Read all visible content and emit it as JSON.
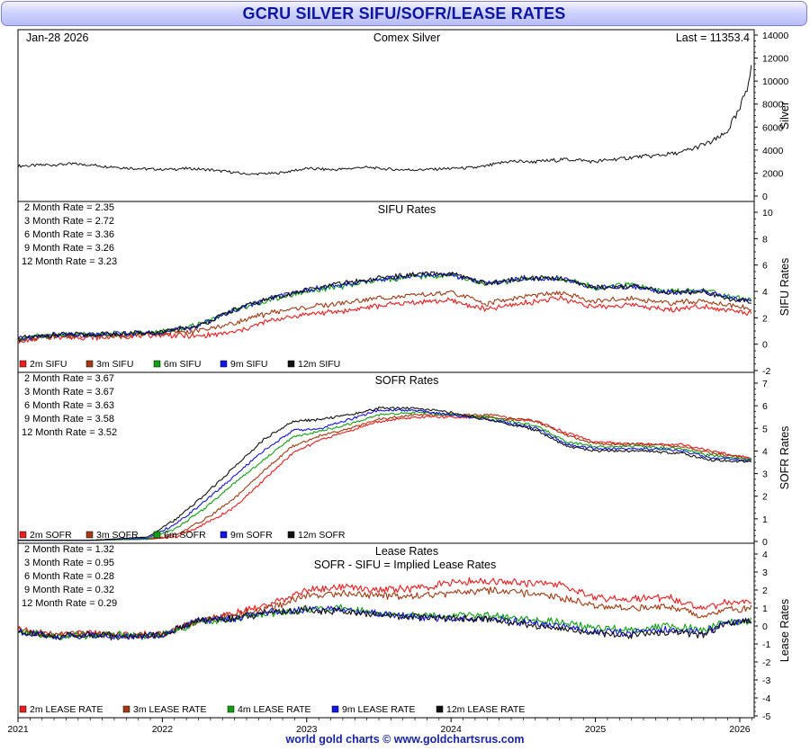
{
  "title": "GCRU SILVER SIFU/SOFR/LEASE RATES",
  "footer": "world gold charts © www.goldchartsrus.com",
  "colors": {
    "title_text": "#0c16a3",
    "footer_text": "#1a24a8",
    "2m": "#ee1c1c",
    "3m": "#a33a12",
    "6m": "#10a010",
    "9m": "#1414e6",
    "12m": "#111111"
  },
  "x_axis": {
    "ticks": [
      "2021",
      "2022",
      "2023",
      "2024",
      "2025",
      "2026"
    ]
  },
  "chart_data": [
    {
      "type": "line",
      "panel": "silver",
      "date_label": "Jan-28 2026",
      "title": "Comex Silver",
      "last_label": "Last = 11353.4",
      "ylabel": "Silver",
      "ylim": [
        0,
        14000
      ],
      "yticks": [
        "0",
        "2000",
        "4000",
        "6000",
        "8000",
        "10000",
        "12000",
        "14000"
      ],
      "x": [
        2021.0,
        2021.2,
        2021.4,
        2021.6,
        2021.8,
        2022.0,
        2022.2,
        2022.4,
        2022.6,
        2022.8,
        2023.0,
        2023.2,
        2023.4,
        2023.6,
        2023.8,
        2024.0,
        2024.2,
        2024.4,
        2024.6,
        2024.8,
        2025.0,
        2025.2,
        2025.4,
        2025.6,
        2025.8,
        2025.9,
        2026.0,
        2026.05,
        2026.08
      ],
      "series": [
        {
          "values": [
            2600,
            2700,
            2800,
            2600,
            2400,
            2300,
            2400,
            2200,
            1900,
            2000,
            2400,
            2300,
            2500,
            2300,
            2300,
            2400,
            2500,
            3000,
            3000,
            3200,
            3000,
            3300,
            3500,
            3800,
            4700,
            5400,
            7500,
            9500,
            11353
          ]
        }
      ]
    },
    {
      "type": "line",
      "panel": "sifu",
      "title": "SIFU Rates",
      "ylabel": "SIFU Rates",
      "ylim": [
        -2,
        10
      ],
      "yticks": [
        "-2",
        "0",
        "2",
        "4",
        "6",
        "8",
        "10"
      ],
      "rate_labels": [
        "2 Month Rate = 2.35",
        "3 Month Rate = 2.72",
        "6 Month Rate = 3.36",
        "9 Month Rate = 3.26",
        "12 Month Rate = 3.23"
      ],
      "legend": [
        "2m SIFU",
        "3m SIFU",
        "6m SIFU",
        "9m SIFU",
        "12m SIFU"
      ],
      "x": [
        2021.0,
        2021.25,
        2021.5,
        2021.75,
        2022.0,
        2022.25,
        2022.5,
        2022.75,
        2023.0,
        2023.25,
        2023.5,
        2023.75,
        2024.0,
        2024.25,
        2024.5,
        2024.75,
        2025.0,
        2025.25,
        2025.5,
        2025.75,
        2025.9,
        2026.08
      ],
      "series": [
        {
          "name": "2m SIFU",
          "values": [
            0.2,
            0.6,
            0.5,
            0.6,
            0.7,
            0.6,
            0.9,
            1.8,
            2.3,
            2.5,
            2.9,
            3.2,
            3.3,
            2.6,
            3.1,
            3.5,
            2.8,
            3.0,
            2.6,
            2.9,
            2.6,
            2.35
          ]
        },
        {
          "name": "3m SIFU",
          "values": [
            0.3,
            0.6,
            0.6,
            0.7,
            0.8,
            1.0,
            1.6,
            2.4,
            2.8,
            3.1,
            3.5,
            3.7,
            3.9,
            3.1,
            3.6,
            3.9,
            3.2,
            3.5,
            3.1,
            3.3,
            3.0,
            2.72
          ]
        },
        {
          "name": "6m SIFU",
          "values": [
            0.4,
            0.7,
            0.7,
            0.8,
            0.9,
            1.5,
            2.6,
            3.4,
            4.0,
            4.4,
            4.8,
            5.1,
            5.2,
            4.5,
            4.9,
            5.0,
            4.3,
            4.5,
            4.0,
            4.1,
            3.7,
            3.36
          ]
        },
        {
          "name": "9m SIFU",
          "values": [
            0.4,
            0.7,
            0.7,
            0.8,
            0.9,
            1.4,
            2.6,
            3.5,
            4.1,
            4.5,
            4.9,
            5.2,
            5.3,
            4.6,
            5.0,
            5.0,
            4.3,
            4.4,
            3.9,
            4.0,
            3.6,
            3.26
          ]
        },
        {
          "name": "12m SIFU",
          "values": [
            0.4,
            0.7,
            0.7,
            0.8,
            0.9,
            1.4,
            2.6,
            3.5,
            4.1,
            4.6,
            5.0,
            5.3,
            5.3,
            4.6,
            5.0,
            5.0,
            4.3,
            4.4,
            3.9,
            4.0,
            3.5,
            3.23
          ]
        }
      ]
    },
    {
      "type": "line",
      "panel": "sofr",
      "title": "SOFR Rates",
      "ylabel": "SOFR Rates",
      "ylim": [
        0,
        7
      ],
      "yticks": [
        "0",
        "1",
        "2",
        "3",
        "4",
        "5",
        "6",
        "7"
      ],
      "rate_labels": [
        "2 Month Rate = 3.67",
        "3 Month Rate = 3.67",
        "6 Month Rate = 3.63",
        "9 Month Rate = 3.58",
        "12 Month Rate = 3.52"
      ],
      "legend": [
        "2m SOFR",
        "3m SOFR",
        "6m SOFR",
        "9m SOFR",
        "12m SOFR"
      ],
      "x": [
        2021.0,
        2021.5,
        2021.9,
        2022.1,
        2022.3,
        2022.5,
        2022.7,
        2022.9,
        2023.1,
        2023.3,
        2023.5,
        2023.75,
        2024.0,
        2024.25,
        2024.6,
        2024.8,
        2025.0,
        2025.3,
        2025.6,
        2025.8,
        2026.08
      ],
      "series": [
        {
          "name": "2m SOFR",
          "values": [
            0.05,
            0.05,
            0.1,
            0.2,
            0.8,
            1.5,
            2.7,
            3.9,
            4.5,
            4.9,
            5.3,
            5.5,
            5.5,
            5.5,
            5.3,
            4.8,
            4.4,
            4.3,
            4.3,
            4.0,
            3.67
          ]
        },
        {
          "name": "3m SOFR",
          "values": [
            0.05,
            0.05,
            0.1,
            0.3,
            1.0,
            1.9,
            3.1,
            4.2,
            4.7,
            5.0,
            5.4,
            5.6,
            5.6,
            5.6,
            5.3,
            4.7,
            4.3,
            4.3,
            4.2,
            3.9,
            3.67
          ]
        },
        {
          "name": "6m SOFR",
          "values": [
            0.05,
            0.05,
            0.1,
            0.6,
            1.5,
            2.6,
            3.6,
            4.6,
            4.9,
            5.2,
            5.6,
            5.7,
            5.6,
            5.5,
            5.1,
            4.4,
            4.2,
            4.2,
            4.1,
            3.8,
            3.63
          ]
        },
        {
          "name": "9m SOFR",
          "values": [
            0.05,
            0.05,
            0.15,
            0.8,
            1.8,
            2.9,
            4.0,
            4.9,
            5.0,
            5.4,
            5.8,
            5.8,
            5.6,
            5.4,
            5.0,
            4.3,
            4.1,
            4.1,
            4.0,
            3.7,
            3.58
          ]
        },
        {
          "name": "12m SOFR",
          "values": [
            0.05,
            0.05,
            0.2,
            1.0,
            2.1,
            3.3,
            4.5,
            5.3,
            5.4,
            5.6,
            5.9,
            5.9,
            5.7,
            5.4,
            4.9,
            4.2,
            4.0,
            4.0,
            3.9,
            3.6,
            3.52
          ]
        }
      ]
    },
    {
      "type": "line",
      "panel": "lease",
      "title": "Lease Rates",
      "subtitle": "SOFR - SIFU = Implied Lease Rates",
      "ylabel": "Lease Rates",
      "ylim": [
        -5,
        4
      ],
      "yticks": [
        "-5",
        "-4",
        "-3",
        "-2",
        "-1",
        "0",
        "1",
        "2",
        "3",
        "4"
      ],
      "rate_labels": [
        "2 Month Rate = 1.32",
        "3 Month Rate = 0.95",
        "6 Month Rate = 0.28",
        "9 Month Rate = 0.32",
        "12 Month Rate = 0.29"
      ],
      "legend": [
        "2m LEASE RATE",
        "3m LEASE RATE",
        "4m LEASE RATE",
        "9m LEASE RATE",
        "12m LEASE RATE"
      ],
      "x": [
        2021.0,
        2021.25,
        2021.5,
        2021.75,
        2022.0,
        2022.25,
        2022.5,
        2022.75,
        2023.0,
        2023.25,
        2023.5,
        2023.75,
        2024.0,
        2024.25,
        2024.5,
        2024.75,
        2025.0,
        2025.25,
        2025.5,
        2025.75,
        2025.9,
        2026.08
      ],
      "series": [
        {
          "name": "2m LEASE RATE",
          "values": [
            -0.2,
            -0.5,
            -0.4,
            -0.5,
            -0.5,
            0.3,
            0.7,
            1.2,
            2.0,
            2.2,
            2.0,
            2.1,
            2.4,
            2.5,
            2.4,
            2.3,
            1.6,
            1.5,
            1.6,
            1.0,
            1.3,
            1.32
          ]
        },
        {
          "name": "3m LEASE RATE",
          "values": [
            -0.2,
            -0.5,
            -0.4,
            -0.5,
            -0.5,
            0.3,
            0.6,
            1.0,
            1.7,
            1.8,
            1.7,
            1.7,
            1.8,
            2.0,
            1.8,
            1.6,
            1.1,
            1.0,
            1.1,
            0.6,
            0.9,
            0.95
          ]
        },
        {
          "name": "4m LEASE RATE",
          "values": [
            -0.3,
            -0.6,
            -0.5,
            -0.5,
            -0.5,
            0.2,
            0.4,
            0.7,
            0.9,
            1.0,
            0.7,
            0.6,
            0.6,
            0.6,
            0.4,
            0.2,
            -0.1,
            -0.2,
            0.0,
            -0.2,
            0.2,
            0.28
          ]
        },
        {
          "name": "9m LEASE RATE",
          "values": [
            -0.3,
            -0.6,
            -0.5,
            -0.6,
            -0.5,
            0.3,
            0.4,
            0.8,
            0.9,
            0.9,
            0.7,
            0.5,
            0.4,
            0.4,
            0.2,
            0.0,
            -0.3,
            -0.4,
            -0.2,
            -0.4,
            0.2,
            0.32
          ]
        },
        {
          "name": "12m LEASE RATE",
          "values": [
            -0.3,
            -0.6,
            -0.5,
            -0.6,
            -0.5,
            0.3,
            0.4,
            0.8,
            0.9,
            0.8,
            0.6,
            0.5,
            0.4,
            0.4,
            0.1,
            -0.1,
            -0.4,
            -0.5,
            -0.3,
            -0.5,
            0.1,
            0.29
          ]
        }
      ]
    }
  ]
}
